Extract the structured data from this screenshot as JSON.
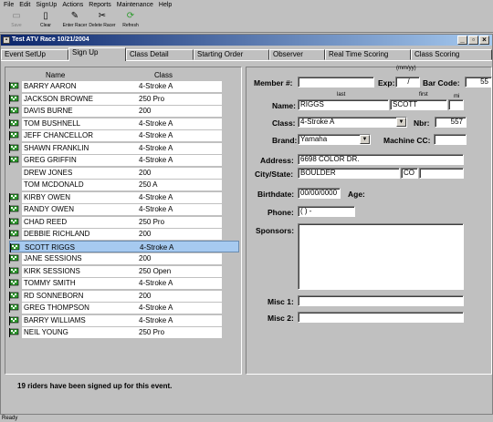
{
  "menu": [
    "File",
    "Edit",
    "SignUp",
    "Actions",
    "Reports",
    "Maintenance",
    "Help"
  ],
  "toolbar": {
    "save": "Save",
    "clear": "Clear",
    "enter_racer": "Enter Racer",
    "delete_racer": "Delete Racer",
    "refresh": "Refresh"
  },
  "window": {
    "title": "Test ATV Race  10/21/2004",
    "icon_glyph": "▪"
  },
  "tabs": [
    "Event SetUp",
    "Sign Up",
    "Class Detail",
    "Starting Order",
    "Observer",
    "Real Time Scoring",
    "Class Scoring"
  ],
  "list": {
    "name_header": "Name",
    "class_header": "Class",
    "riders": [
      {
        "name": "BARRY AARON",
        "class": "4-Stroke A",
        "flag": true
      },
      {
        "name": "JACKSON BROWNE",
        "class": "250 Pro",
        "flag": true
      },
      {
        "name": "DAVIS BURNE",
        "class": "200",
        "flag": true
      },
      {
        "name": "TOM BUSHNELL",
        "class": "4-Stroke A",
        "flag": true
      },
      {
        "name": "JEFF CHANCELLOR",
        "class": "4-Stroke A",
        "flag": true
      },
      {
        "name": "SHAWN FRANKLIN",
        "class": "4-Stroke A",
        "flag": true
      },
      {
        "name": "GREG GRIFFIN",
        "class": "4-Stroke A",
        "flag": true
      },
      {
        "name": "DREW JONES",
        "class": "200",
        "flag": false
      },
      {
        "name": "TOM MCDONALD",
        "class": "250 A",
        "flag": false
      },
      {
        "name": "KIRBY OWEN",
        "class": "4-Stroke A",
        "flag": true
      },
      {
        "name": "RANDY OWEN",
        "class": "4-Stroke A",
        "flag": true
      },
      {
        "name": "CHAD REED",
        "class": "250 Pro",
        "flag": true
      },
      {
        "name": "DEBBIE RICHLAND",
        "class": "200",
        "flag": true
      },
      {
        "name": "SCOTT RIGGS",
        "class": "4-Stroke A",
        "flag": true,
        "selected": true
      },
      {
        "name": "JANE SESSIONS",
        "class": "200",
        "flag": true
      },
      {
        "name": "KIRK SESSIONS",
        "class": "250 Open",
        "flag": true
      },
      {
        "name": "TOMMY SMITH",
        "class": "4-Stroke A",
        "flag": true
      },
      {
        "name": "RD SONNEBORN",
        "class": "200",
        "flag": true
      },
      {
        "name": "GREG THOMPSON",
        "class": "4-Stroke A",
        "flag": true
      },
      {
        "name": "BARRY WILLIAMS",
        "class": "4-Stroke A",
        "flag": true
      },
      {
        "name": "NEIL YOUNG",
        "class": "250 Pro",
        "flag": true
      }
    ],
    "summary": "19 riders have been signed up for this event."
  },
  "form": {
    "member_label": "Member #:",
    "member_value": "",
    "exp_label": "Exp:",
    "exp_hint": "(mm/yy)",
    "exp_value": "/",
    "barcode_label": "Bar Code:",
    "barcode_value": "55",
    "name_label": "Name:",
    "last_hint": "last",
    "first_hint": "first",
    "mi_hint": "mi",
    "last_value": "RIGGS",
    "first_value": "SCOTT",
    "mi_value": "",
    "class_label": "Class:",
    "class_value": "4-Stroke A",
    "nbr_label": "Nbr:",
    "nbr_value": "557",
    "brand_label": "Brand:",
    "brand_value": "Yamaha",
    "cc_label": "Machine CC:",
    "cc_value": "",
    "address_label": "Address:",
    "address_value": "6698 COLOR DR.",
    "citystate_label": "City/State:",
    "city_value": "BOULDER",
    "state_value": "CO",
    "zip_value": "",
    "birthdate_label": "Birthdate:",
    "birthdate_value": "00/00/0000",
    "age_label": "Age:",
    "phone_label": "Phone:",
    "phone_value": "(  )   -",
    "sponsors_label": "Sponsors:",
    "sponsors_value": "",
    "misc1_label": "Misc 1:",
    "misc1_value": "",
    "misc2_label": "Misc 2:",
    "misc2_value": ""
  },
  "status": {
    "text": "Ready"
  },
  "colors": {
    "title_start": "#0a246a",
    "title_end": "#a6caf0",
    "selection": "#a6caf0",
    "flag_green": "#2e9a2e"
  }
}
